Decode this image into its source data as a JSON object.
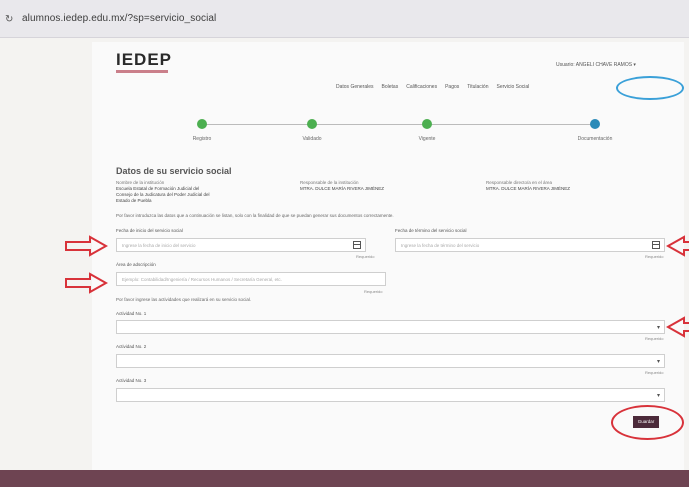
{
  "browser": {
    "url": "alumnos.iedep.edu.mx/?sp=servicio_social",
    "refresh_icon": "refresh-icon"
  },
  "header": {
    "logo": "IEDEP",
    "user_menu": "Usuario: ANGELI CHAVE RAMOS ▾"
  },
  "top_nav": {
    "items": [
      "Datos Generales",
      "Boletas",
      "Calificaciones",
      "Pagos",
      "Titulación",
      "Servicio Social"
    ]
  },
  "stepper": {
    "steps": [
      {
        "label": "Registro",
        "color": "#4caf50"
      },
      {
        "label": "Validado",
        "color": "#4caf50"
      },
      {
        "label": "Vigente",
        "color": "#4caf50"
      },
      {
        "label": "Documentación",
        "color": "#2a8ab8"
      }
    ]
  },
  "form": {
    "title": "Datos de su servicio social",
    "info": [
      {
        "label": "Nombre de la institución",
        "value": "Escuela Estatal de Formación Judicial del Consejo de la Judicatura del Poder Judicial del Estado de Puebla"
      },
      {
        "label": "Responsable de la institución",
        "value": "MTRA. DULCE MARÍA RIVERA JIMÉNEZ"
      },
      {
        "label": "Responsable directo/a en el área",
        "value": "MTRA. DULCE MARÍA RIVERA JIMÉNEZ"
      }
    ],
    "instruction_dates": "Por favor introduzca las datos que a continuación se listan, solo con la finalidad de que se puedan generar sus documentos correctamente.",
    "start_date": {
      "label": "Fecha de inicio del servicio social",
      "placeholder": "Ingrese la fecha de inicio del servicio",
      "helper": "Requerido"
    },
    "end_date": {
      "label": "Fecha de término del servicio social",
      "placeholder": "Ingrese la fecha de término del servicio",
      "helper": "Requerido"
    },
    "area": {
      "label": "Área de adscripción",
      "placeholder": "Ejemplo: Contabilidad/Ingeniería / Recursos Humanos / Secretaría General, etc.",
      "helper": "Requerido"
    },
    "instruction_activities": "Por favor ingrese las actividades que realizará en su servicio social.",
    "activities": [
      {
        "label": "Actividad No. 1",
        "helper": "Requerido"
      },
      {
        "label": "Actividad No. 2",
        "helper": "Requerido"
      },
      {
        "label": "Actividad No. 3",
        "helper": ""
      }
    ],
    "submit_label": "Guardar"
  },
  "annotations": {
    "arrow_color": "#d8323a",
    "circle_blue": "#3aa0d8",
    "circle_red": "#d8323a"
  },
  "colors": {
    "footer": "#6e4452",
    "button": "#4c2a3a"
  }
}
